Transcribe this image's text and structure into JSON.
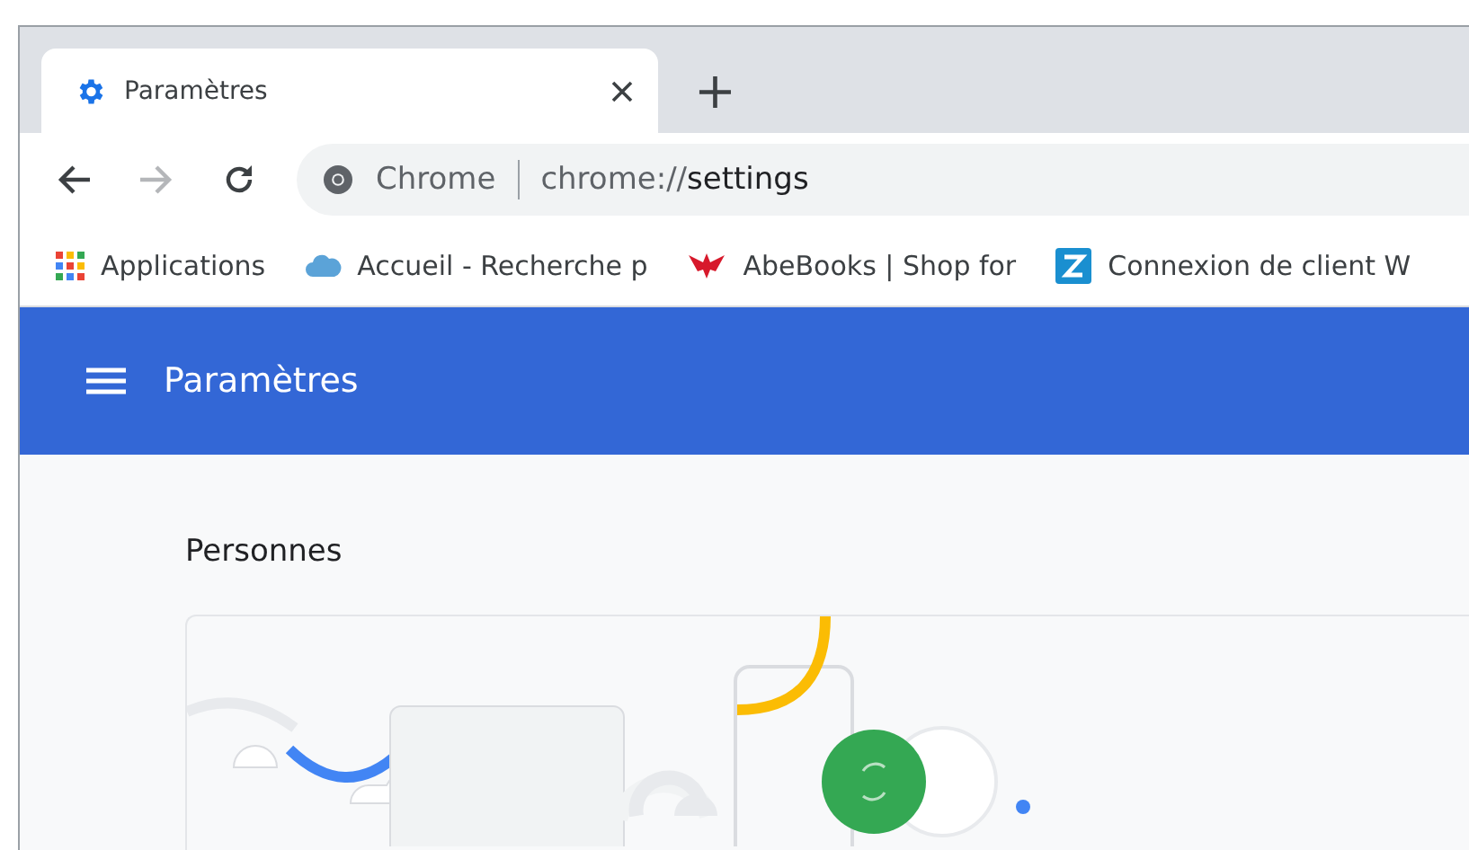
{
  "tabs": [
    {
      "title": "Paramètres",
      "selected": true
    }
  ],
  "new_tab": "+",
  "toolbar": {
    "omnibox": {
      "site": "Chrome",
      "url_prefix": "chrome://",
      "url_path": "settings"
    }
  },
  "bookmarks": [
    {
      "label": "Applications",
      "kind": "apps"
    },
    {
      "label": "Accueil - Recherche p",
      "kind": "cloud"
    },
    {
      "label": "AbeBooks | Shop for",
      "kind": "bird"
    },
    {
      "label": "Connexion de client W",
      "kind": "z"
    }
  ],
  "header": {
    "title": "Paramètres"
  },
  "section": {
    "title": "Personnes"
  }
}
